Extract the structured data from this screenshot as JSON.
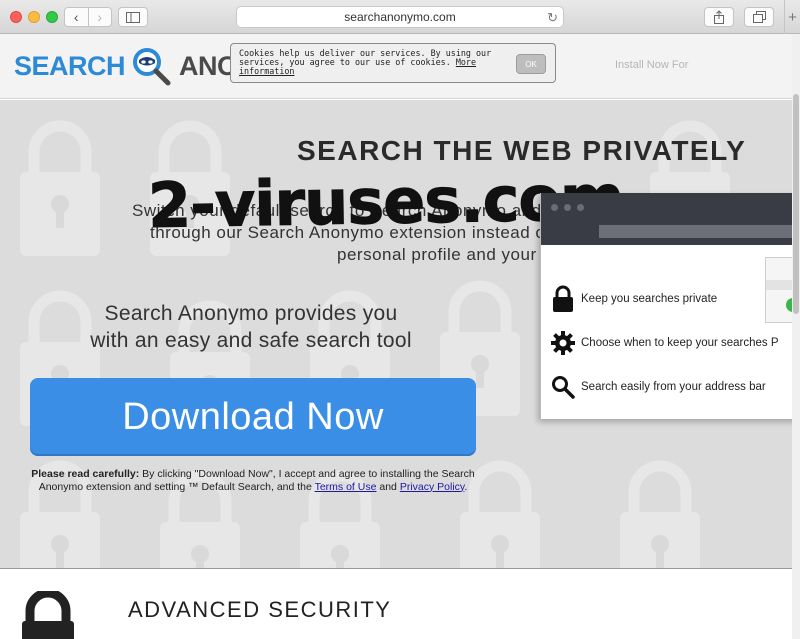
{
  "browser": {
    "url": "searchanonymo.com",
    "back_icon": "chevron-left-icon",
    "forward_icon": "chevron-right-icon",
    "sidebar_icon": "sidebar-icon",
    "reload_icon": "reload-icon",
    "share_icon": "share-icon",
    "tabs_icon": "tabs-icon",
    "new_tab_icon": "plus-icon"
  },
  "header": {
    "logo_word_1": "SEARCH",
    "logo_word_2": "ANONYMO",
    "link_text": "Install Now For"
  },
  "cookie": {
    "text": "Cookies help us deliver our services. By using our services, you agree to our use of cookies.",
    "link": "More information",
    "ok_label": "OK"
  },
  "hero": {
    "title": "SEARCH THE WEB PRIVATELY",
    "subtitle_lines": [
      "Switch your default search to Search Anonymo and become safer on the",
      "through our Search Anonymo extension instead of search engines that",
      "personal profile and your search history."
    ],
    "watermark": "2-viruses.com",
    "tagline_line_1": "Search Anonymo provides you",
    "tagline_line_2": "with an easy and safe search tool",
    "download_label": "Download Now"
  },
  "disclaimer": {
    "bold": "Please read carefully:",
    "text_1": " By clicking \"Download Now\", I accept and agree to installing the Search Anonymo extension and setting ™ Default Search, and the ",
    "terms": "Terms of Use",
    "and": " and ",
    "privacy": "Privacy Policy",
    "end": "."
  },
  "mockup": {
    "items": [
      {
        "icon": "lock-icon",
        "label": "Keep you searches private"
      },
      {
        "icon": "gear-icon",
        "label": "Choose when to keep your searches P"
      },
      {
        "icon": "search-icon",
        "label": "Search easily from your address bar"
      }
    ]
  },
  "section": {
    "title": "ADVANCED SECURITY"
  },
  "colors": {
    "accent": "#3a8ee6",
    "logo_blue": "#2d8ad6",
    "hero_bg": "#dcdcdc"
  }
}
